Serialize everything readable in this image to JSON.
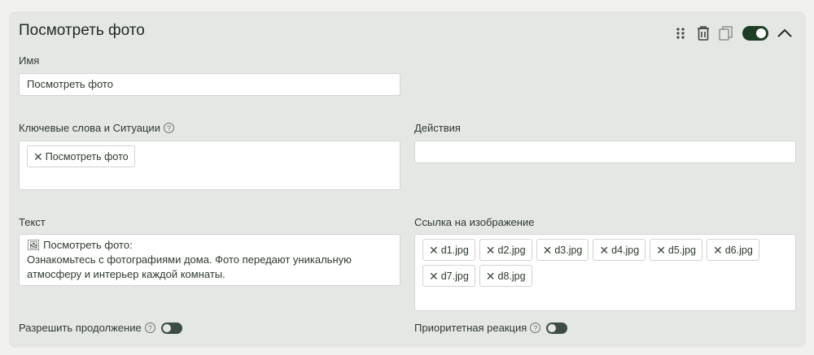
{
  "card": {
    "title": "Посмотреть фото",
    "toolbar": {
      "drag": "drag-dots-icon",
      "delete": "trash-icon",
      "copy": "copy-icon",
      "enabled": true,
      "collapse": "chevron-up-icon"
    }
  },
  "fields": {
    "name_label": "Имя",
    "name_value": "Посмотреть фото",
    "keywords_label": "Ключевые слова и Ситуации",
    "keywords": [
      "Посмотреть фото"
    ],
    "actions_label": "Действия",
    "actions_value": "",
    "text_label": "Текст",
    "text_value": "🖼 Посмотреть фото:\nОзнакомьтесь с фотографиями дома. Фото передают уникальную атмосферу и интерьер каждой комнаты.",
    "images_label": "Ссылка на изображение",
    "images": [
      "d1.jpg",
      "d2.jpg",
      "d3.jpg",
      "d4.jpg",
      "d5.jpg",
      "d6.jpg",
      "d7.jpg",
      "d8.jpg"
    ],
    "allow_continue_label": "Разрешить продолжение",
    "allow_continue": false,
    "priority_label": "Приоритетная реакция",
    "priority": false
  },
  "help_glyph": "?",
  "remove_glyph": "✕"
}
